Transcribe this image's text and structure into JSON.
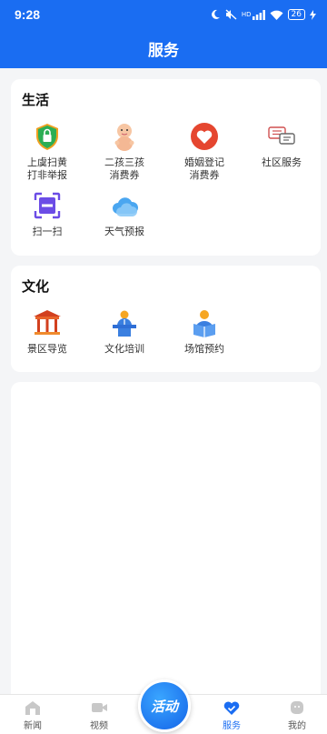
{
  "status_bar": {
    "time": "9:28",
    "signal_label": "HD",
    "battery": "26"
  },
  "header": {
    "title": "服务"
  },
  "life": {
    "title": "生活",
    "items": [
      {
        "label": "上虞扫黄\n打非举报",
        "icon": "shield-icon"
      },
      {
        "label": "二孩三孩\n消费券",
        "icon": "baby-icon"
      },
      {
        "label": "婚姻登记\n消费券",
        "icon": "heart-icon"
      },
      {
        "label": "社区服务",
        "icon": "chat-bubbles-icon"
      },
      {
        "label": "扫一扫",
        "icon": "scan-icon"
      },
      {
        "label": "天气预报",
        "icon": "cloud-icon"
      }
    ]
  },
  "culture": {
    "title": "文化",
    "items": [
      {
        "label": "景区导览",
        "icon": "pavilion-icon"
      },
      {
        "label": "文化培训",
        "icon": "lecturer-icon"
      },
      {
        "label": "场馆预约",
        "icon": "reader-icon"
      }
    ]
  },
  "bottom_nav": {
    "items": [
      {
        "label": "新闻",
        "icon": "news-icon"
      },
      {
        "label": "视频",
        "icon": "video-icon"
      },
      {
        "label": "服务",
        "icon": "heart-check-icon",
        "active": true
      },
      {
        "label": "我的",
        "icon": "profile-icon"
      }
    ],
    "center_button": "活动"
  },
  "colors": {
    "brand": "#1a6df2",
    "background": "#f4f5f7"
  }
}
